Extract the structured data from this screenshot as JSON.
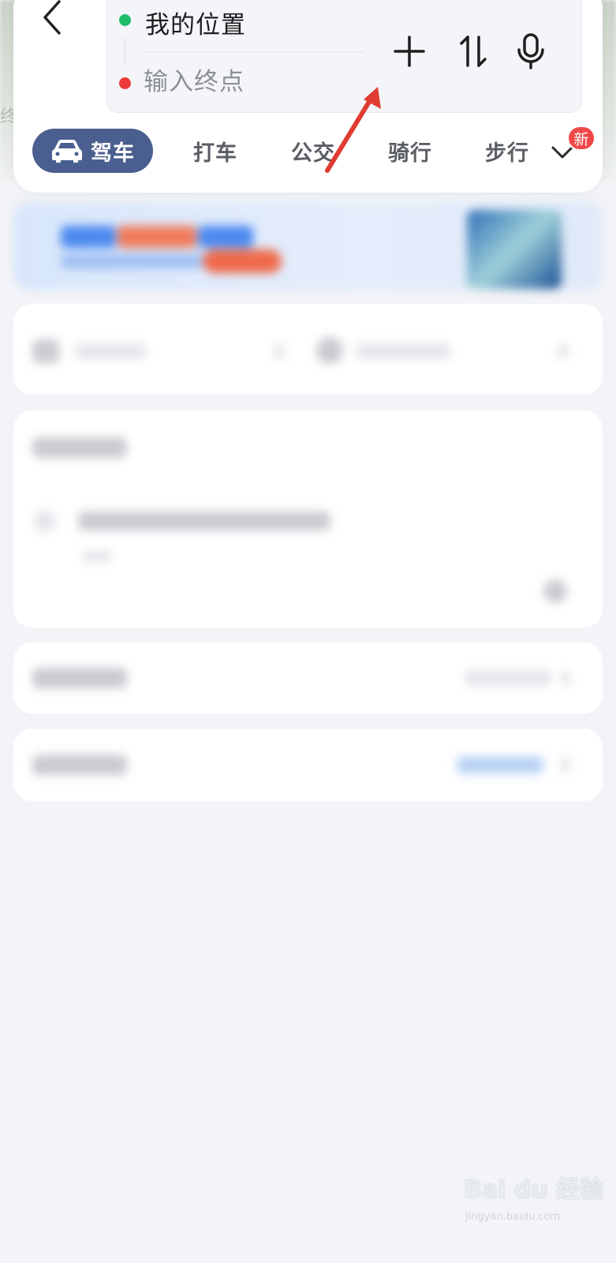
{
  "route": {
    "start_label": "我的位置",
    "end_placeholder": "输入终点"
  },
  "tabs": [
    {
      "label": "驾车",
      "active": true
    },
    {
      "label": "打车"
    },
    {
      "label": "公交"
    },
    {
      "label": "骑行"
    },
    {
      "label": "步行"
    }
  ],
  "badge": {
    "new_label": "新"
  },
  "icons": {
    "back": "chevron-left-icon",
    "add": "plus-icon",
    "swap": "swap-vertical-icon",
    "voice": "microphone-icon",
    "more": "chevron-down-icon",
    "drive": "car-icon"
  },
  "colors": {
    "active_tab": "#4a5f8f",
    "start_dot": "#1fbd6b",
    "end_dot": "#ee3b3b",
    "annotation_arrow": "#e03c32",
    "badge": "#f04848"
  },
  "watermark": {
    "main": "Bai du 经验",
    "sub": "jingyan.baidu.com"
  }
}
